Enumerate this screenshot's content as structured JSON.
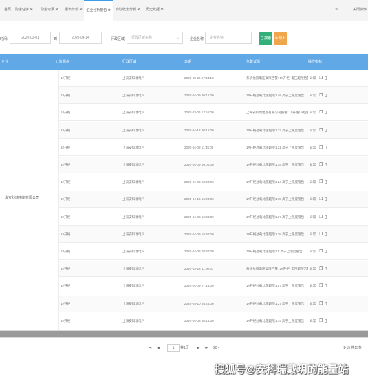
{
  "tabs": [
    "首页",
    "隐患任务 ⊗",
    "隐患记录 ⊗",
    "报表分析 ⊗",
    "企业分析报告 ⊗",
    "启助收集分析 ⊗",
    "历史数据 ⊗"
  ],
  "tabs_right": "关闭操作",
  "filters": {
    "time_label": "时间:",
    "start_date": "2020-03-01",
    "to_label": "到",
    "end_date": "2020-04-14",
    "region_label": "行政区域:",
    "region_placeholder": "行政区域名称",
    "company_label": "企业名称:",
    "company_placeholder": "企业名称",
    "search_button": "Q 搜索",
    "export_button": "⊕ 导出"
  },
  "table": {
    "headers": [
      "企业",
      "⇕ 监测点",
      "行政区域",
      "日期",
      "告警详情",
      "操作指标"
    ],
    "merged_company": "上海安科瑞电能有限公司",
    "rows": [
      {
        "point": "1#开柜",
        "region": "上海安科瑞电气",
        "date": "2020-03-26 17:44:18",
        "detail": "系统依照电压高限告警: 1#开柜, 电压超限告警"
      },
      {
        "point": "1#开柜",
        "region": "上海安科瑞电气",
        "date": "2020-04-09 00:15:00",
        "detail": "1#开柜过载比值超限1.48 高于上限度警告"
      },
      {
        "point": "1#开柜",
        "region": "上海安科瑞电气",
        "date": "2020-03-06 12:55:00",
        "detail": "上海安科瑞电能有限公司报警, 1#开柜Ua超限, 告警"
      },
      {
        "point": "1#开柜",
        "region": "上海安科瑞电气",
        "date": "2020-04-12 00:15:00",
        "detail": "1#开柜过载比值超限1.32 高于上限度警告"
      },
      {
        "point": "1#开柜",
        "region": "上海安科瑞电气",
        "date": "2020-04-08 11:45:00",
        "detail": "1#开柜过载比值超限1.21 高于上限度警告"
      },
      {
        "point": "1#开柜",
        "region": "上海安科瑞电气",
        "date": "2020-04-09 10:00:00",
        "detail": "1#开柜过载比值超限1.35 高于上限度警告"
      },
      {
        "point": "1#开柜",
        "region": "上海安科瑞电气",
        "date": "2020-04-08 10:30:00",
        "detail": "1#开柜过载比值超限1.24 高于上限度警告"
      },
      {
        "point": "1#开柜",
        "region": "上海安科瑞电气",
        "date": "2020-04-13 16:00:00",
        "detail": "1#开柜过载比值超限1.15 高于上限度警告"
      },
      {
        "point": "1#开柜",
        "region": "上海安科瑞电气",
        "date": "2020-04-08 16:30:00",
        "detail": "1#开柜过载比值超限1.37 高于上限度警告"
      },
      {
        "point": "1#开柜",
        "region": "上海安科瑞电气",
        "date": "2020-04-09 16:30:00",
        "detail": "1#开柜过载比值超限1.28 高于上限度警告"
      },
      {
        "point": "1#开柜",
        "region": "上海安科瑞电气",
        "date": "2020-04-08 08:30:00",
        "detail": "1#开柜过载比值超限1.5 高于上限度警告"
      },
      {
        "point": "1#开柜",
        "region": "上海安科瑞电气",
        "date": "2020-03-23 11:00:47",
        "detail": "系统依照电压高限告警: 1#开柜, 电压超限告警"
      },
      {
        "point": "1#开柜",
        "region": "上海安科瑞电气",
        "date": "2020-04-09 07:45:00",
        "detail": "1#开柜过载比值超限1.07 高于上限度警告"
      },
      {
        "point": "1#开柜",
        "region": "上海安科瑞电气",
        "date": "2020-04-10 08:45:00",
        "detail": "1#开柜过载比值超限1.27 高于上限度警告"
      },
      {
        "point": "1#开柜",
        "region": "上海安科瑞电气",
        "date": "2020-04-08 10:15:00",
        "detail": "1#开柜过载比值超限1.14 高于上限度警告"
      }
    ],
    "action_label": "异常",
    "action_icons": [
      "view-icon",
      "detail-icon"
    ]
  },
  "pagination": {
    "first": "⏮",
    "prev": "◀",
    "page_value": "1",
    "total_pages": "共1页",
    "next": "▶",
    "last": "⏭",
    "page_size": "20 ▾",
    "summary": "1-15 共15条"
  },
  "watermark": "搜狐号@安科瑞戴玥的能量站"
}
